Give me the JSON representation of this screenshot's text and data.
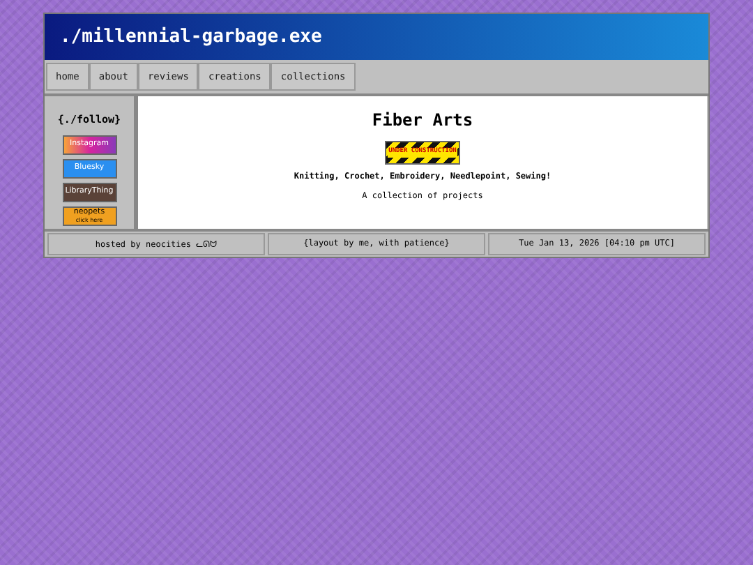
{
  "header": {
    "title": "./millennial-garbage.exe"
  },
  "nav": [
    {
      "label": "home"
    },
    {
      "label": "about"
    },
    {
      "label": "reviews"
    },
    {
      "label": "creations"
    },
    {
      "label": "collections"
    }
  ],
  "sidebar": {
    "heading": "{./follow}",
    "badges": [
      {
        "kind": "instagram",
        "label": "Instagram"
      },
      {
        "kind": "bluesky",
        "label": "Bluesky"
      },
      {
        "kind": "librarything",
        "label": "LibraryThing"
      },
      {
        "kind": "neopets",
        "label": "neopets",
        "sublabel": "click here"
      }
    ]
  },
  "main": {
    "title": "Fiber Arts",
    "banner": "UNDER CONSTRUCTION",
    "subtitle": "Knitting, Crochet, Embroidery, Needlepoint, Sewing!",
    "description": "A collection of projects"
  },
  "footer": [
    "hosted by neocities ᓚᘏᗢ",
    "{layout by me, with patience}",
    "Tue Jan 13, 2026 [04:10 pm UTC]"
  ]
}
